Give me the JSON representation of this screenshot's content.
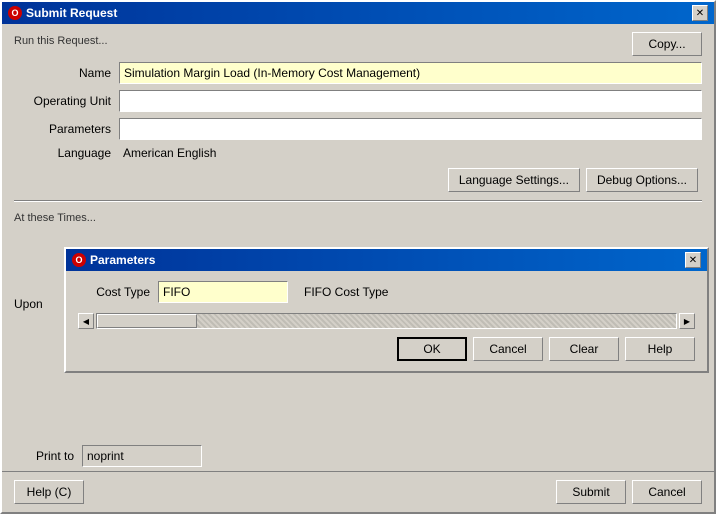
{
  "mainWindow": {
    "title": "Submit Request",
    "icon": "O",
    "closeChar": "✕"
  },
  "section1": {
    "label": "Run this Request...",
    "copyButton": "Copy..."
  },
  "form": {
    "nameLabel": "Name",
    "nameValue": "Simulation Margin Load (In-Memory Cost Management)",
    "operatingUnitLabel": "Operating Unit",
    "operatingUnitValue": "",
    "parametersLabel": "Parameters",
    "parametersValue": "",
    "languageLabel": "Language",
    "languageValue": "American English"
  },
  "buttons1": {
    "languageSettings": "Language Settings...",
    "debugOptions": "Debug Options..."
  },
  "section2": {
    "label": "At these Times..."
  },
  "uponLabel": "Upon",
  "parametersWindow": {
    "title": "Parameters",
    "icon": "O",
    "closeChar": "✕"
  },
  "paramsForm": {
    "costTypeLabel": "Cost Type",
    "costTypeValue": "FIFO",
    "costTypeDesc": "FIFO Cost Type"
  },
  "paramsButtons": {
    "ok": "OK",
    "cancel": "Cancel",
    "clear": "Clear",
    "help": "Help"
  },
  "printRow": {
    "label": "Print to",
    "value": "noprint"
  },
  "bottomButtons": {
    "help": "Help (C)",
    "submit": "Submit",
    "cancel": "Cancel"
  }
}
